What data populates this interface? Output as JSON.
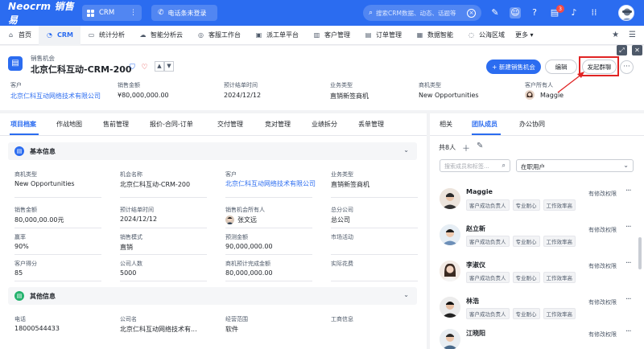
{
  "topbar": {
    "logo": "Neocrm 销售易",
    "app_name": "CRM",
    "phone_status": "电话条未登录",
    "search_placeholder": "搜索CRM数据、动态、话题等",
    "notification_count": "3"
  },
  "nav": {
    "items": [
      {
        "label": "首页",
        "icon": "home-icon"
      },
      {
        "label": "CRM",
        "icon": "crm-icon",
        "active": true
      },
      {
        "label": "统计分析",
        "icon": "stats-icon"
      },
      {
        "label": "智能分析云",
        "icon": "cloud-icon"
      },
      {
        "label": "客服工作台",
        "icon": "service-icon"
      },
      {
        "label": "派工单平台",
        "icon": "dispatch-icon"
      },
      {
        "label": "客户管理",
        "icon": "customer-icon"
      },
      {
        "label": "订单管理",
        "icon": "order-icon"
      },
      {
        "label": "数据智能",
        "icon": "data-icon"
      },
      {
        "label": "公海区域",
        "icon": "pool-icon"
      }
    ],
    "more_label": "更多"
  },
  "header": {
    "object_type": "销售机会",
    "title": "北京仁科互动-CRM-200",
    "new_button": "+ 新建销售机会",
    "edit_button": "编辑",
    "group_chat_button": "发起群聊",
    "fields": [
      {
        "label": "客户",
        "value": "北京仁科互动网络技术有限公司",
        "link": true
      },
      {
        "label": "销售金额",
        "value": "¥80,000,000.00"
      },
      {
        "label": "预计结单时间",
        "value": "2024/12/12"
      },
      {
        "label": "业务类型",
        "value": "直销新签商机"
      },
      {
        "label": "商机类型",
        "value": "New Opportunities"
      },
      {
        "label": "客户所有人",
        "value": "Maggie"
      }
    ]
  },
  "left": {
    "tabs": [
      "项目档案",
      "作战地图",
      "售前管理",
      "报价-合同-订单",
      "交付管理",
      "竞对管理",
      "业绩拆分",
      "丢单管理"
    ],
    "section_basic": "基本信息",
    "section_other": "其他信息",
    "basic_fields": [
      {
        "label": "商机类型",
        "value": "New Opportunities"
      },
      {
        "label": "机会名称",
        "value": "北京仁科互动-CRM-200"
      },
      {
        "label": "客户",
        "value": "北京仁科互动网络技术有限公司"
      },
      {
        "label": "业务类型",
        "value": "直销新签商机"
      },
      {
        "label": "销售金额",
        "value": "80,000,00.00元"
      },
      {
        "label": "预计结单时间",
        "value": "2024/12/12"
      },
      {
        "label": "销售机会所有人",
        "value": "张文远"
      },
      {
        "label": "总分公司",
        "value": "总公司"
      },
      {
        "label": "赢率",
        "value": "90%"
      },
      {
        "label": "销售模式",
        "value": "直销"
      },
      {
        "label": "预测金额",
        "value": "90,000,000.00"
      },
      {
        "label": "市场活动",
        "value": ""
      },
      {
        "label": "客户得分",
        "value": "85"
      },
      {
        "label": "公司人数",
        "value": "5000"
      },
      {
        "label": "商机预计完成金额",
        "value": "80,000,000.00"
      },
      {
        "label": "实际花费",
        "value": ""
      }
    ],
    "other_fields": [
      {
        "label": "电话",
        "value": "18000544433"
      },
      {
        "label": "公司名",
        "value": "北京仁科互动网络技术有..."
      },
      {
        "label": "经营范围",
        "value": "软件"
      },
      {
        "label": "工商信息",
        "value": ""
      }
    ]
  },
  "right": {
    "tabs": [
      "相关",
      "团队成员",
      "办公协同"
    ],
    "count": "共8人",
    "search_placeholder": "搜索成员和标签...",
    "filter_value": "在职用户",
    "members": [
      {
        "name": "Maggie",
        "tags": [
          "客户成功负责人",
          "专业耐心",
          "工作效率高"
        ],
        "permission": "有修改权限"
      },
      {
        "name": "赵立新",
        "tags": [
          "客户成功负责人",
          "专业耐心",
          "工作效率高"
        ],
        "permission": "有修改权限"
      },
      {
        "name": "李淑仪",
        "tags": [
          "客户成功负责人",
          "专业耐心",
          "工作效率高"
        ],
        "permission": "有修改权限"
      },
      {
        "name": "林浩",
        "tags": [
          "客户成功负责人",
          "专业耐心",
          "工作效率高"
        ],
        "permission": "有修改权限"
      },
      {
        "name": "江晓阳",
        "tags": [],
        "permission": "有修改权限"
      }
    ]
  },
  "colors": {
    "primary": "#2b6cf0",
    "annotation_red": "#e02424"
  }
}
